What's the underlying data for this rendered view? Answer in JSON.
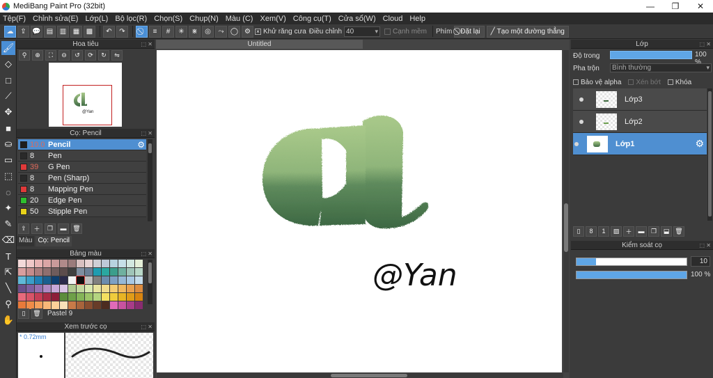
{
  "app": {
    "title": "MediBang Paint Pro (32bit)"
  },
  "window_controls": {
    "minimize": "—",
    "maximize": "❐",
    "close": "✕"
  },
  "menu": [
    "Tệp(F)",
    "Chỉnh sửa(E)",
    "Lớp(L)",
    "Bộ lọc(R)",
    "Chọn(S)",
    "Chụp(N)",
    "Màu (C)",
    "Xem(V)",
    "Công cụ(T)",
    "Cửa sổ(W)",
    "Cloud",
    "Help"
  ],
  "toolbar": {
    "antialias_label": "Khử răng cưa",
    "antialias_checked": true,
    "adjust_label": "Điều chỉnh",
    "adjust_value": "40",
    "soft_edge_label": "Cạnh mềm",
    "key_label": "Phím",
    "reset_label": "Đặt lại",
    "straight_line_label": "Tạo một đường thẳng"
  },
  "navigator": {
    "title": "Hoa tiêu",
    "signature": "@Yan"
  },
  "brush_panel": {
    "title": "Cọ: Pencil",
    "items": [
      {
        "size": "10.0",
        "name": "Pencil",
        "color": "#1e1e1e",
        "selected": true,
        "size_red": true
      },
      {
        "size": "8",
        "name": "Pen",
        "color": "#2a2a2a",
        "selected": false,
        "size_red": false
      },
      {
        "size": "39",
        "name": "G Pen",
        "color": "#e03a3a",
        "selected": false,
        "size_red": true
      },
      {
        "size": "8",
        "name": "Pen (Sharp)",
        "color": "#2a2a2a",
        "selected": false,
        "size_red": false
      },
      {
        "size": "8",
        "name": "Mapping Pen",
        "color": "#e03a3a",
        "selected": false,
        "size_red": false
      },
      {
        "size": "20",
        "name": "Edge Pen",
        "color": "#2fbf2f",
        "selected": false,
        "size_red": false
      },
      {
        "size": "50",
        "name": "Stipple Pen",
        "color": "#e8d21a",
        "selected": false,
        "size_red": false
      }
    ],
    "tabs": [
      "Màu",
      "Cọ: Pencil"
    ]
  },
  "palette": {
    "title": "Bảng màu",
    "name": "Pastel 9",
    "colors": [
      "#f3d9d9",
      "#f0c8c8",
      "#e8b4b4",
      "#dba5a5",
      "#c99a9a",
      "#b08a8a",
      "#9a7b7b",
      "#d8c0c0",
      "#e8d4d4",
      "#cfcfd6",
      "#bfc8d8",
      "#b8d4e0",
      "#c6e0e8",
      "#d2e8e0",
      "#e4efd8",
      "#d89e9e",
      "#c48c8c",
      "#a87c7c",
      "#8f6f6f",
      "#6f5c5c",
      "#5c4c4c",
      "#3f3f3f",
      "#7e8ea0",
      "#6a7f96",
      "#1f9cb0",
      "#2aa7a0",
      "#3b9e8c",
      "#6fb0a0",
      "#9fc4b8",
      "#b8d8c8",
      "#5fb8d8",
      "#3a9ec8",
      "#1f7fb4",
      "#1b5f8f",
      "#0f3f6f",
      "#2a2a4a",
      "#f2f2f2",
      "#101010",
      "#c0c0c0",
      "#808080",
      "#6b8cae",
      "#7ea0c4",
      "#96b8d8",
      "#a8c8e4",
      "#c4dcec",
      "#6a4e8a",
      "#7e5ea0",
      "#9670b0",
      "#b08ac4",
      "#c8a8d8",
      "#d8c4e4",
      "#b0c890",
      "#c4d8a0",
      "#d8e8b0",
      "#e8e4a0",
      "#f0dc8c",
      "#f4cc74",
      "#f0b860",
      "#e8a050",
      "#dc8c40",
      "#e86a7c",
      "#d85468",
      "#c43e56",
      "#a82c46",
      "#8c1e3a",
      "#5c8c3c",
      "#6ea048",
      "#84b458",
      "#9cc468",
      "#b4d480",
      "#f4e060",
      "#f0cc3c",
      "#e8b424",
      "#e09c18",
      "#d88410",
      "#e87a3a",
      "#f08c48",
      "#f4a05c",
      "#f8b878",
      "#fcd098",
      "#f8e0b8",
      "#c87a48",
      "#a8643c",
      "#884e30",
      "#683c28",
      "#4c2c20",
      "#e06ab8",
      "#c852a0",
      "#a83c88",
      "#882c70"
    ]
  },
  "preview": {
    "title": "Xem trước cọ",
    "size_text": "* 0.72mm"
  },
  "document": {
    "tab_title": "Untitled",
    "signature_text": "@Yan"
  },
  "layer_panel": {
    "title": "Lớp",
    "opacity_label": "Độ trong",
    "opacity_value": "100 %",
    "blend_label": "Pha trộn",
    "blend_value": "Bình thường",
    "protect_alpha_label": "Bảo vệ alpha",
    "clip_label": "Xén bớt",
    "lock_label": "Khóa",
    "layers": [
      {
        "name": "Lớp3",
        "selected": false
      },
      {
        "name": "Lớp2",
        "selected": false
      },
      {
        "name": "Lớp1",
        "selected": true
      }
    ]
  },
  "brush_control": {
    "title": "Kiểm soát cọ",
    "size_value": "10",
    "size_fraction": 0.18,
    "opacity_value": "100 %",
    "opacity_fraction": 1.0
  },
  "colors": {
    "accent": "#4f8fd1",
    "letter_top": "#a9c98a",
    "letter_bottom": "#3f6b44"
  }
}
